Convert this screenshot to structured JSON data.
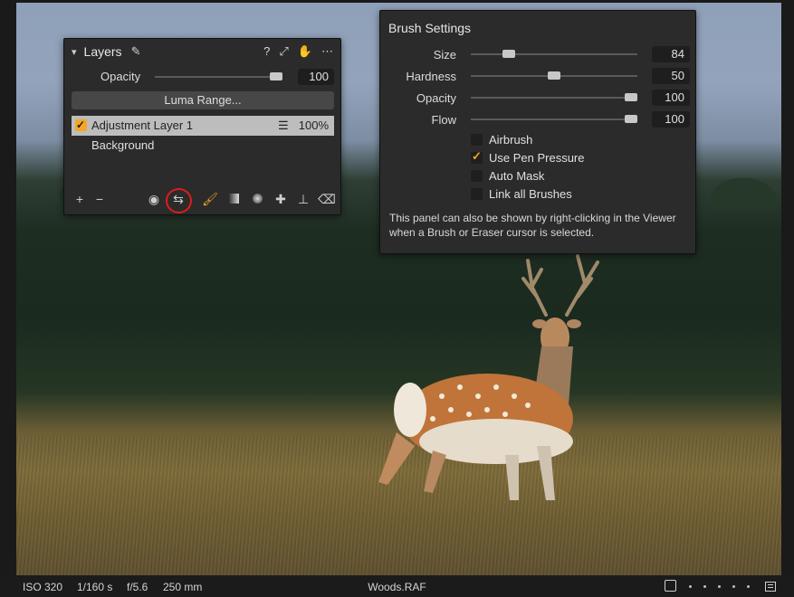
{
  "layers_panel": {
    "title": "Layers",
    "header_icons": [
      "pencil-icon",
      "help-icon",
      "expand-icon",
      "hand-icon",
      "more-icon"
    ],
    "help_label": "?",
    "opacity_label": "Opacity",
    "opacity_value": "100",
    "opacity_level": 1.0,
    "luma_range_label": "Luma Range...",
    "layers": [
      {
        "name": "Adjustment Layer 1",
        "opacity": "100%",
        "checked": true,
        "selected": true
      },
      {
        "name": "Background",
        "checked": false,
        "selected": false
      }
    ],
    "tools": [
      "add-layer-icon",
      "remove-layer-icon",
      "eye-icon",
      "adjustments-icon",
      "brush-icon",
      "linear-gradient-icon",
      "radial-gradient-icon",
      "heal-icon",
      "clone-stamp-icon",
      "eraser-icon"
    ]
  },
  "brush_panel": {
    "title": "Brush Settings",
    "sliders": [
      {
        "label": "Size",
        "value": "84",
        "level": 0.2
      },
      {
        "label": "Hardness",
        "value": "50",
        "level": 0.5
      },
      {
        "label": "Opacity",
        "value": "100",
        "level": 1.0
      },
      {
        "label": "Flow",
        "value": "100",
        "level": 1.0
      }
    ],
    "checkboxes": [
      {
        "label": "Airbrush",
        "checked": false
      },
      {
        "label": "Use Pen Pressure",
        "checked": true
      },
      {
        "label": "Auto Mask",
        "checked": false
      },
      {
        "label": "Link all Brushes",
        "checked": false
      }
    ],
    "note": "This panel can also be shown by right-clicking in the Viewer when a Brush or Eraser cursor is selected."
  },
  "status_bar": {
    "iso": "ISO 320",
    "shutter": "1/160 s",
    "aperture": "f/5.6",
    "focal_length": "250 mm",
    "filename": "Woods.RAF"
  },
  "colors": {
    "accent": "#f5a623",
    "highlight_circle": "#e01b1b",
    "panel_bg": "#2b2b2b"
  }
}
